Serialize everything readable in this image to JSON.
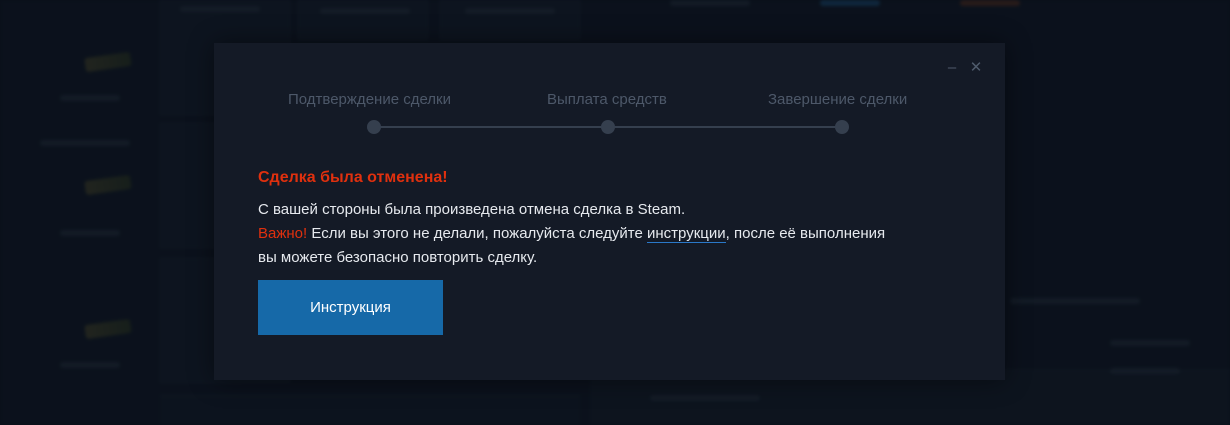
{
  "dialog": {
    "controls": {
      "minimize_glyph": "–",
      "close_glyph": "✕"
    },
    "steps": [
      {
        "label": "Подтверждение сделки"
      },
      {
        "label": "Выплата средств"
      },
      {
        "label": "Завершение сделки"
      }
    ],
    "message": {
      "title": "Сделка была отменена!",
      "line1": "С вашей стороны была произведена отмена сделка в Steam.",
      "important_label": "Важно!",
      "line2_before_link": " Если вы этого не делали, пожалуйста следуйте ",
      "link_text": "инструкции",
      "line2_after_link": ", после её выполнения",
      "line3": "вы можете безопасно повторить сделку."
    },
    "button_label": "Инструкция"
  },
  "colors": {
    "modal_bg": "#141a26",
    "accent_red": "#e0300e",
    "button_blue": "#1669a8",
    "step_gray": "#353f4e"
  },
  "icons": [
    "minimize-icon",
    "close-icon"
  ]
}
